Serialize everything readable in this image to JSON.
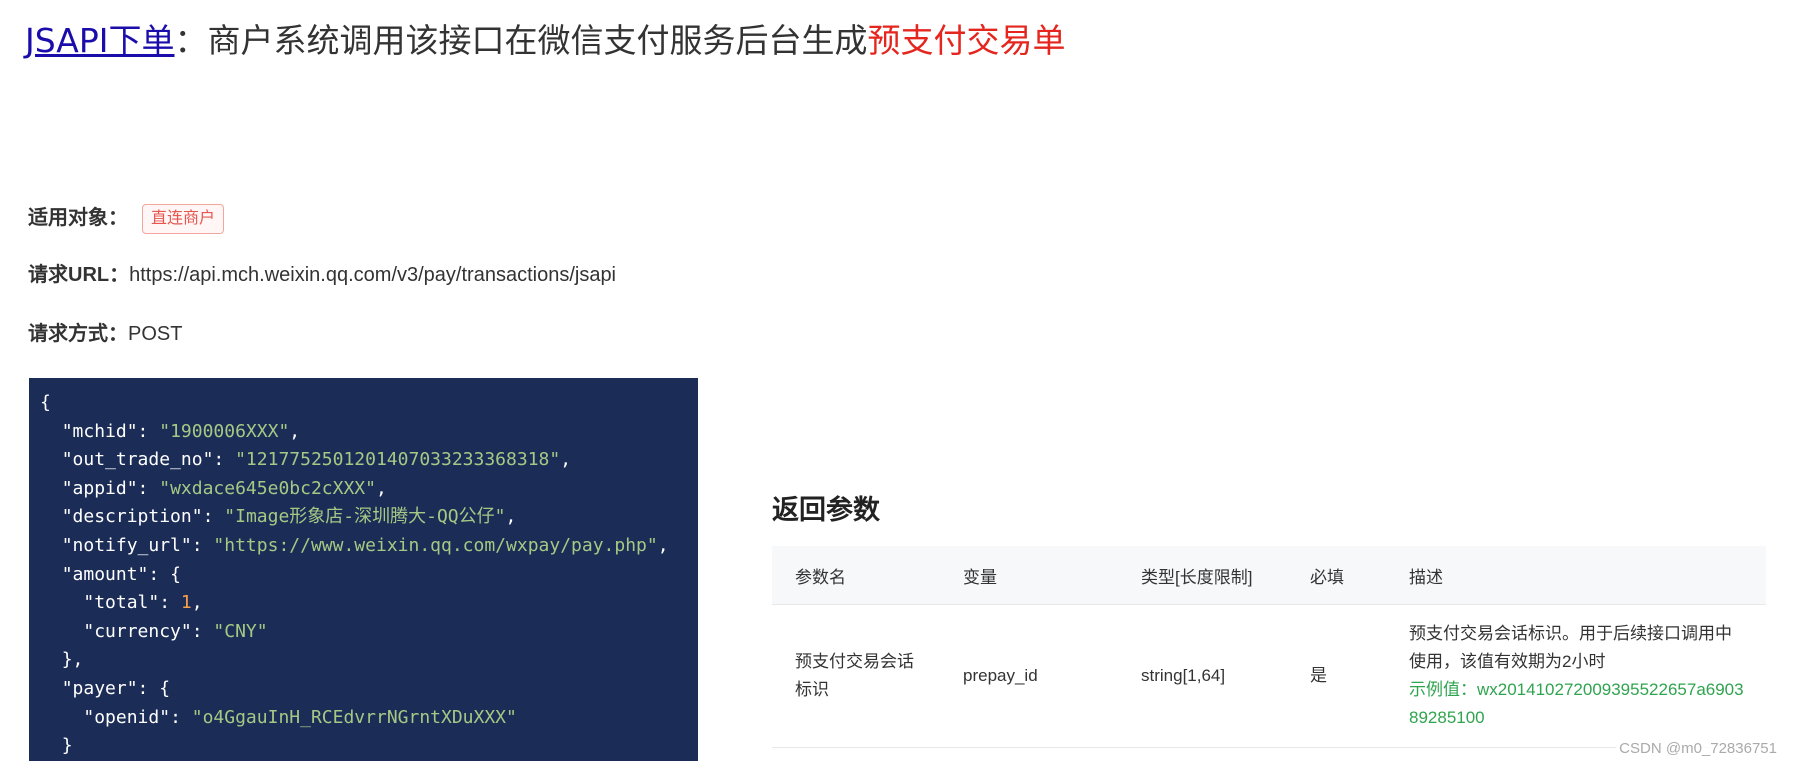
{
  "heading": {
    "link_text": "JSAPI下单",
    "middle_text": "：商户系统调用该接口在微信支付服务后台生成",
    "highlight_text": "预支付交易单"
  },
  "info": {
    "target_label": "适用对象：",
    "target_tag": "直连商户",
    "url_label": "请求URL：",
    "url_value": "https://api.mch.weixin.qq.com/v3/pay/transactions/jsapi",
    "method_label": "请求方式：",
    "method_value": "POST"
  },
  "request_example": {
    "lines": [
      {
        "indent": 0,
        "text": "{"
      },
      {
        "indent": 1,
        "key": "mchid",
        "str": "1900006XXX",
        "comma": true
      },
      {
        "indent": 1,
        "key": "out_trade_no",
        "str": "1217752501201407033233368318",
        "comma": true
      },
      {
        "indent": 1,
        "key": "appid",
        "str": "wxdace645e0bc2cXXX",
        "comma": true
      },
      {
        "indent": 1,
        "key": "description",
        "str": "Image形象店-深圳腾大-QQ公仔",
        "comma": true
      },
      {
        "indent": 1,
        "key": "notify_url",
        "str": "https://www.weixin.qq.com/wxpay/pay.php",
        "comma": true
      },
      {
        "indent": 1,
        "key": "amount",
        "open": "{"
      },
      {
        "indent": 2,
        "key": "total",
        "num": "1",
        "comma": true
      },
      {
        "indent": 2,
        "key": "currency",
        "str": "CNY"
      },
      {
        "indent": 1,
        "text": "},"
      },
      {
        "indent": 1,
        "key": "payer",
        "open": "{"
      },
      {
        "indent": 2,
        "key": "openid",
        "str": "o4GgauInH_RCEdvrrNGrntXDuXXX"
      },
      {
        "indent": 1,
        "text": "}"
      }
    ]
  },
  "response": {
    "title": "返回参数",
    "headers": [
      "参数名",
      "变量",
      "类型[长度限制]",
      "必填",
      "描述"
    ],
    "rows": [
      {
        "name": "预支付交易会话标识",
        "variable": "prepay_id",
        "type": "string[1,64]",
        "required": "是",
        "description": "预支付交易会话标识。用于后续接口调用中使用，该值有效期为2小时",
        "example": "示例值：wx201410272009395522657a690389285100"
      }
    ]
  },
  "watermark": "CSDN @m0_72836751",
  "colors": {
    "link": "#1a0dab",
    "highlight": "#e5261f",
    "code_bg": "#1b2c57",
    "code_string": "#a7c884",
    "code_number": "#f7a04c",
    "example_green": "#2fa44f"
  }
}
